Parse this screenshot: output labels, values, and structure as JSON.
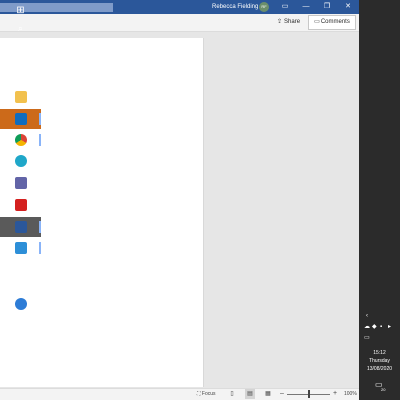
{
  "titlebar": {
    "user_name": "Rebecca Fielding",
    "avatar_initials": "RF",
    "colors": {
      "brand": "#2b579a"
    }
  },
  "ribbon": {
    "share_label": "Share",
    "comments_label": "Comments"
  },
  "statusbar": {
    "focus_label": "Focus",
    "zoom": "100%"
  },
  "taskbar": {
    "items": [
      {
        "icon": "windows-start-icon"
      },
      {
        "icon": "search-icon"
      },
      {
        "icon": "cortana-icon"
      },
      {
        "icon": "task-view-icon"
      },
      {
        "icon": "file-explorer-icon"
      },
      {
        "icon": "outlook-icon"
      },
      {
        "icon": "chrome-icon"
      },
      {
        "icon": "edge-icon"
      },
      {
        "icon": "teams-icon"
      },
      {
        "icon": "acrobat-icon"
      },
      {
        "icon": "word-icon"
      },
      {
        "icon": "photos-icon"
      }
    ],
    "clock": {
      "time": "15:12",
      "day": "Thursday",
      "date": "13/08/2020"
    },
    "notification_count": "20"
  }
}
